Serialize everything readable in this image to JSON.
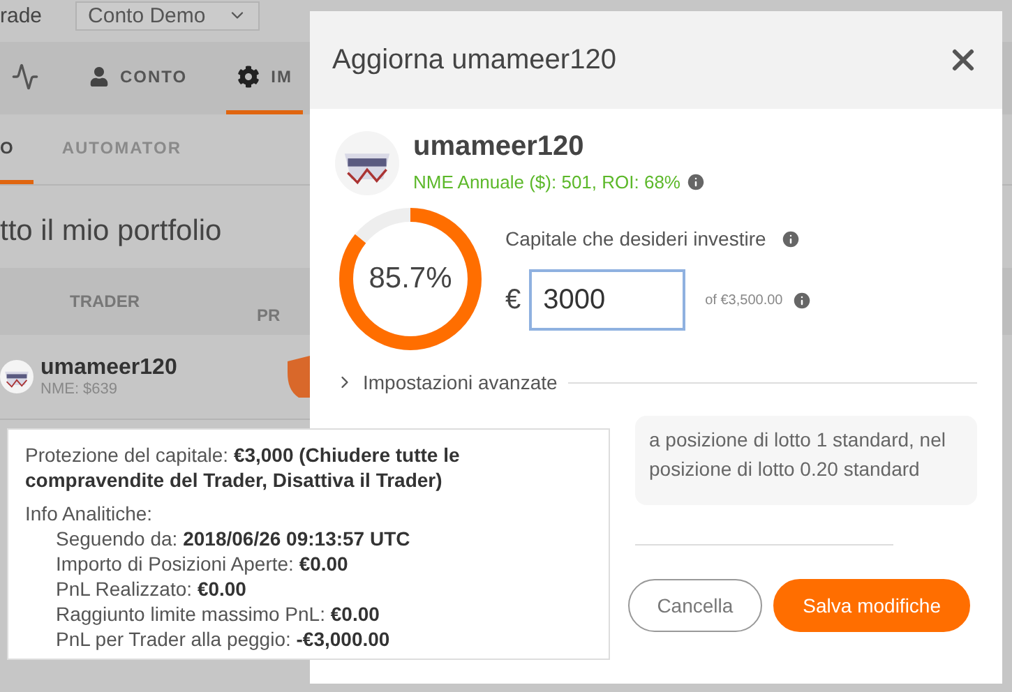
{
  "header": {
    "account_label": "rade",
    "account_select": "Conto Demo"
  },
  "nav_tabs": [
    {
      "kind": "chart",
      "selected": false
    },
    {
      "kind": "person",
      "label": "CONTO",
      "selected": false
    },
    {
      "kind": "gear",
      "label": "IM",
      "selected": true
    }
  ],
  "sub_tabs": [
    {
      "label": "O",
      "selected": true
    },
    {
      "label": "AUTOMATOR",
      "selected": false
    }
  ],
  "page_title": "tto il mio portfolio",
  "table": {
    "columns": [
      "TRADER",
      "PR"
    ],
    "rows": [
      {
        "trader": "umameer120",
        "nme": "NME: $639"
      }
    ]
  },
  "dialog": {
    "title": "Aggiorna umameer120",
    "trader": {
      "name": "umameer120",
      "stats": "NME Annuale ($): 501, ROI: 68%"
    },
    "allocation": {
      "level": 0.857,
      "percent": "85.7%"
    },
    "capital": {
      "label": "Capitale che desideri investire",
      "currency": "€",
      "value": "3000",
      "max": "of €3,500.00"
    },
    "advanced": {
      "label": "Impostazioni avanzate",
      "expanded": false
    },
    "note_lines": [
      "a posizione di lotto 1 standard, nel",
      "posizione di lotto 0.20 standard"
    ],
    "buttons": [
      {
        "label": "Cancella",
        "kind": "secondary"
      },
      {
        "label": "Salva modifiche",
        "kind": "primary"
      }
    ]
  },
  "tooltip": {
    "protection": "Protezione del capitale: **€3,000 (Chiudere tutte le compravendite del Trader, Disattiva il Trader)**",
    "analytics_title": "Info Analitiche:",
    "analytics": [
      "Seguendo da: **2018/06/26 09:13:57 UTC**",
      "Importo di Posizioni Aperte: **€0.00**",
      "PnL Realizzato: **€0.00**",
      "Raggiunto limite massimo PnL: **€0.00**",
      "PnL per Trader alla peggio: **-€3,000.00**"
    ]
  }
}
